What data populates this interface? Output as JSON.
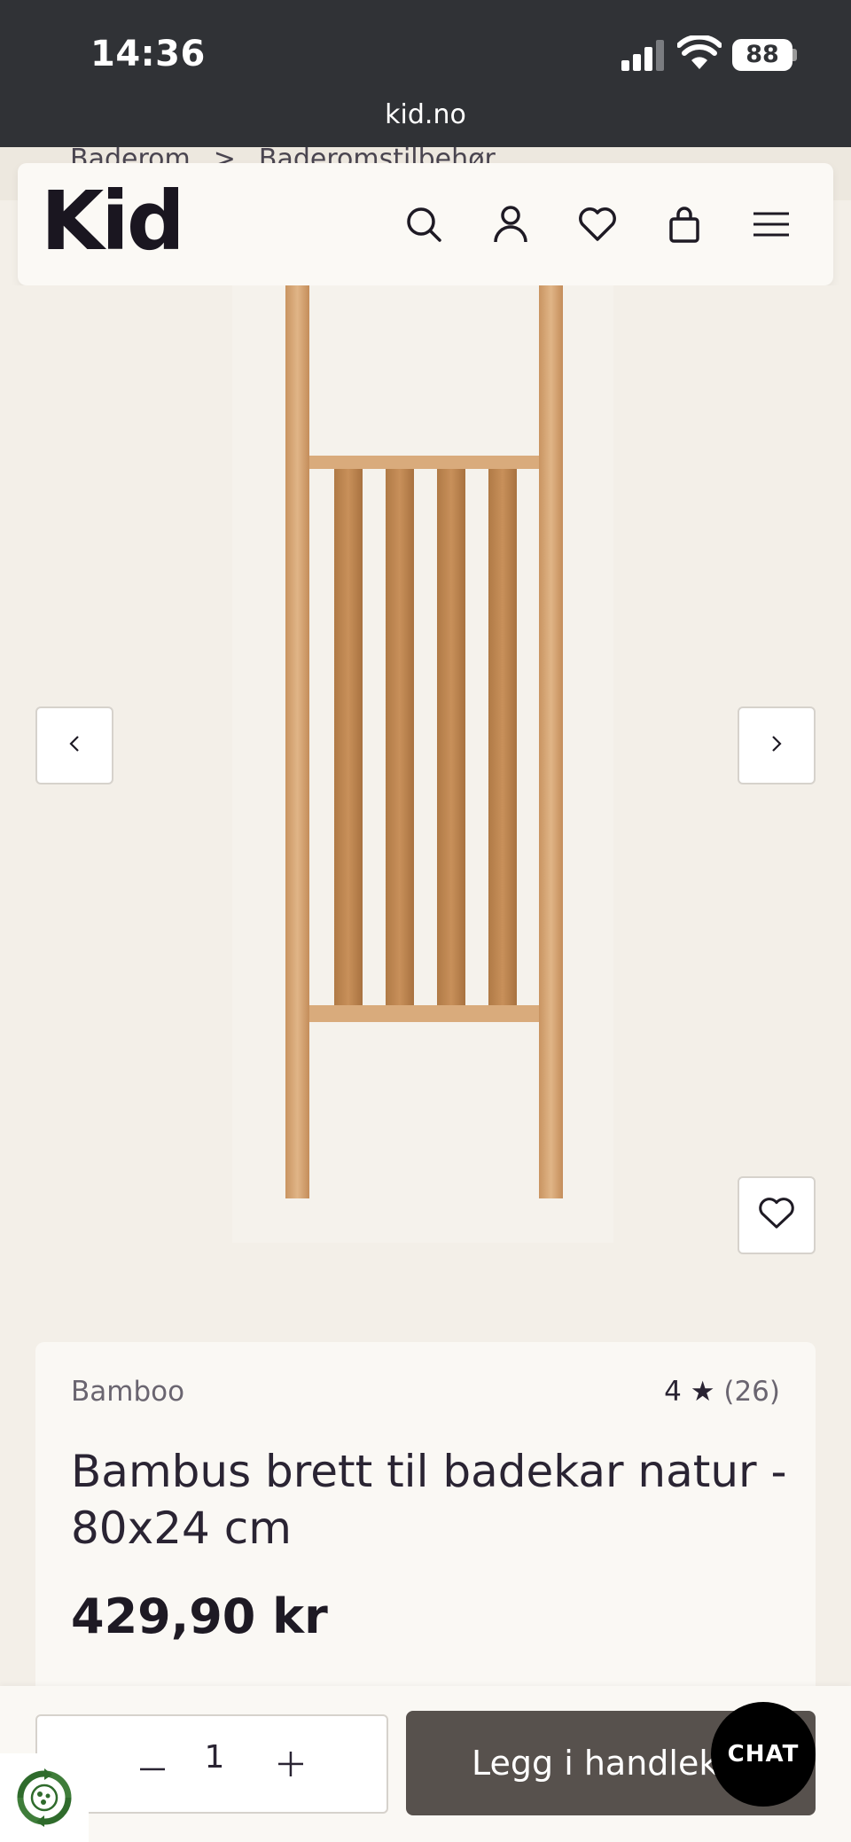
{
  "status": {
    "time": "14:36",
    "battery": "88",
    "url": "kid.no"
  },
  "breadcrumb": [
    "Baderom",
    ">",
    "Baderomstilbehør"
  ],
  "header": {
    "logo": "Kid",
    "icons": [
      "search-icon",
      "account-icon",
      "wishlist-heart-icon",
      "shopping-bag-icon",
      "menu-icon"
    ]
  },
  "gallery": {
    "prev_icon": "chevron-left-icon",
    "next_icon": "chevron-right-icon",
    "favorite_icon": "heart-icon"
  },
  "product": {
    "brand": "Bamboo",
    "rating_value": "4",
    "rating_star": "★",
    "rating_count": "(26)",
    "title": "Bambus brett til badekar natur - 80x24 cm",
    "price": "429,90 kr"
  },
  "cart": {
    "quantity": "1",
    "add_label": "Legg i handlekurv",
    "chat_label": "CHAT"
  },
  "colors": {
    "status_bar": "#303236",
    "page_bg": "#f3efe8",
    "card_bg": "#faf8f4",
    "add_button": "#57514d",
    "wood": "#d4a473"
  }
}
